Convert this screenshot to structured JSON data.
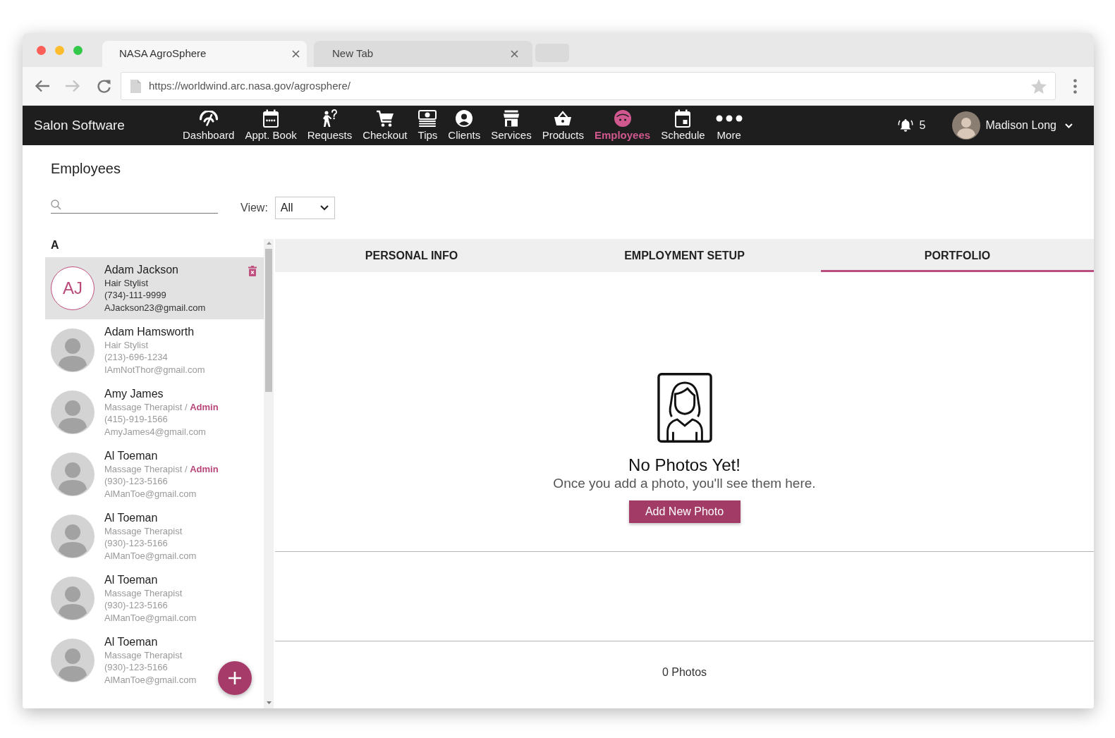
{
  "browser": {
    "tabs": [
      {
        "title": "NASA AgroSphere",
        "selected": true
      },
      {
        "title": "New Tab",
        "selected": false
      }
    ],
    "url": "https://worldwind.arc.nasa.gov/agrosphere/"
  },
  "app_bar": {
    "brand": "Salon Software",
    "nav": [
      {
        "label": "Dashboard",
        "selected": false
      },
      {
        "label": "Appt. Book",
        "selected": false
      },
      {
        "label": "Requests",
        "selected": false
      },
      {
        "label": "Checkout",
        "selected": false
      },
      {
        "label": "Tips",
        "selected": false
      },
      {
        "label": "Clients",
        "selected": false
      },
      {
        "label": "Services",
        "selected": false
      },
      {
        "label": "Products",
        "selected": false
      },
      {
        "label": "Employees",
        "selected": true
      },
      {
        "label": "Schedule",
        "selected": false
      },
      {
        "label": "More",
        "selected": false
      }
    ],
    "notifications": "5",
    "user": "Madison Long"
  },
  "page": {
    "title": "Employees",
    "view_filter": {
      "label": "View:",
      "value": "All"
    }
  },
  "employee_list": {
    "groups": [
      {
        "letter": "A",
        "items": [
          {
            "kind": "initials",
            "initials": "AJ",
            "name": "Adam Jackson",
            "role": "Hair Stylist",
            "phone": "(734)-111-9999",
            "email": "AJackson23@gmail.com",
            "selected": true
          },
          {
            "kind": "photo",
            "name": "Adam Hamsworth",
            "role": "Hair Stylist",
            "phone": "(213)-696-1234",
            "email": "IAmNotThor@gmail.com",
            "selected": false
          },
          {
            "kind": "photo",
            "name": "Amy James",
            "role": "Massage Therapist / **Admin**",
            "phone": "(415)-919-1566",
            "email": "AmyJames4@gmail.com",
            "selected": false
          },
          {
            "kind": "photo",
            "name": "Al Toeman",
            "role": "Massage Therapist / **Admin**",
            "phone": "(930)-123-5166",
            "email": "AlManToe@gmail.com",
            "selected": false
          },
          {
            "kind": "photo",
            "name": "Al Toeman",
            "role": "Massage Therapist",
            "phone": "(930)-123-5166",
            "email": "AlManToe@gmail.com",
            "selected": false
          },
          {
            "kind": "photo",
            "name": "Al Toeman",
            "role": "Massage Therapist",
            "phone": "(930)-123-5166",
            "email": "AlManToe@gmail.com",
            "selected": false
          },
          {
            "kind": "photo",
            "name": "Al Toeman",
            "role": "Massage Therapist",
            "phone": "(930)-123-5166",
            "email": "AlManToe@gmail.com",
            "selected": false
          }
        ]
      }
    ]
  },
  "profile_tabs": [
    {
      "label": "PERSONAL INFO",
      "selected": false
    },
    {
      "label": "EMPLOYMENT SETUP",
      "selected": false
    },
    {
      "label": "PORTFOLIO",
      "selected": true
    }
  ],
  "portfolio": {
    "empty_title": "No Photos Yet!",
    "empty_message": "Once you add a photo, you'll see them here.",
    "add_button": "Add New Photo",
    "count": "0 Photos"
  }
}
